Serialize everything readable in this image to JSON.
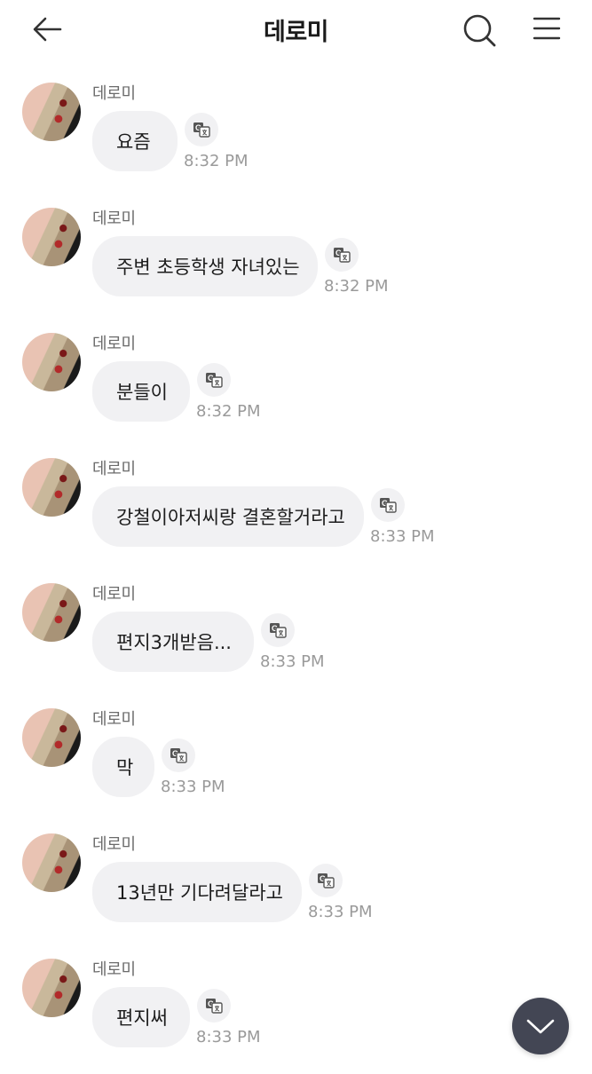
{
  "header": {
    "title": "데로미",
    "back_icon": "arrow-left-icon",
    "search_icon": "search-icon",
    "menu_icon": "hamburger-menu-icon"
  },
  "messages": [
    {
      "sender": "데로미",
      "text": "요즘",
      "time": "8:32 PM"
    },
    {
      "sender": "데로미",
      "text": "주변 초등학생 자녀있는",
      "time": "8:32 PM"
    },
    {
      "sender": "데로미",
      "text": "분들이",
      "time": "8:32 PM"
    },
    {
      "sender": "데로미",
      "text": "강철이아저씨랑 결혼할거라고",
      "time": "8:33 PM"
    },
    {
      "sender": "데로미",
      "text": "편지3개받음...",
      "time": "8:33 PM"
    },
    {
      "sender": "데로미",
      "text": "막",
      "time": "8:33 PM"
    },
    {
      "sender": "데로미",
      "text": "13년만 기다려달라고",
      "time": "8:33 PM"
    },
    {
      "sender": "데로미",
      "text": "편지써",
      "time": "8:33 PM"
    }
  ],
  "translate_icon": "translate-icon",
  "scroll_down_icon": "chevron-down-icon",
  "colors": {
    "bubble": "#f1f1f3",
    "time": "#9a9a9a",
    "sender": "#6b6b6b",
    "fab": "#434654"
  }
}
